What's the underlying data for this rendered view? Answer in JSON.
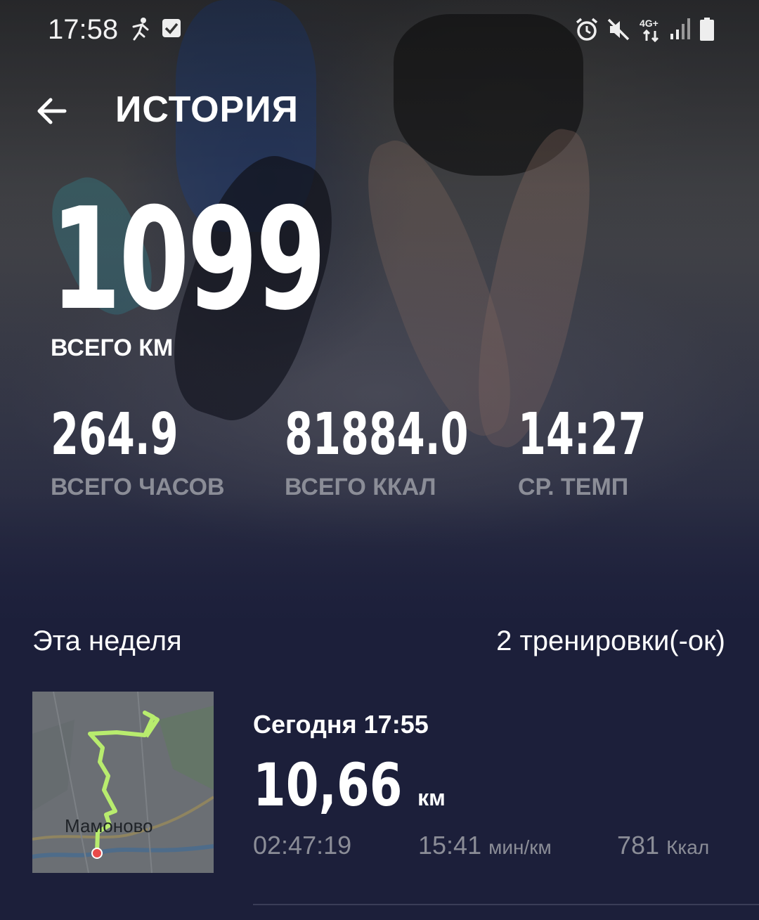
{
  "status_bar": {
    "time": "17:58",
    "icons": [
      "running-icon",
      "checkbox-icon",
      "alarm-icon",
      "mute-icon",
      "network-4g-icon",
      "signal-icon",
      "battery-icon"
    ],
    "network_label": "4G+"
  },
  "header": {
    "title": "ИСТОРИЯ",
    "back_icon": "arrow-left-icon"
  },
  "summary": {
    "total_km": "1099",
    "total_km_label": "ВСЕГО КМ",
    "stats": [
      {
        "value": "264.9",
        "label": "ВСЕГО ЧАСОВ"
      },
      {
        "value": "81884.0",
        "label": "ВСЕГО ККАЛ"
      },
      {
        "value": "14:27",
        "label": "СР. ТЕМП"
      }
    ]
  },
  "week": {
    "title": "Эта неделя",
    "count": "2 тренировки(-ок)"
  },
  "workouts": [
    {
      "date": "Сегодня 17:55",
      "distance": "10,66",
      "distance_unit": "км",
      "duration": "02:47:19",
      "pace": "15:41",
      "pace_unit": "мин/км",
      "calories": "781",
      "calories_unit": "Ккал",
      "map_place": "Мамоново"
    }
  ],
  "colors": {
    "background": "#1c1f3a",
    "text": "#ffffff",
    "muted": "#8b8d97",
    "route": "#b8ec6e",
    "start_marker": "#e84a4a"
  }
}
